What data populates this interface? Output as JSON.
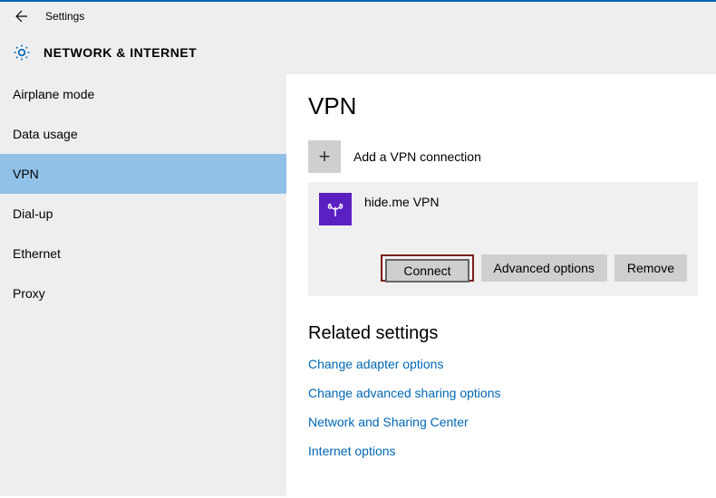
{
  "app": {
    "title": "Settings",
    "section": "NETWORK & INTERNET"
  },
  "sidebar": {
    "items": [
      {
        "label": "Airplane mode",
        "selected": false
      },
      {
        "label": "Data usage",
        "selected": false
      },
      {
        "label": "VPN",
        "selected": true
      },
      {
        "label": "Dial-up",
        "selected": false
      },
      {
        "label": "Ethernet",
        "selected": false
      },
      {
        "label": "Proxy",
        "selected": false
      }
    ]
  },
  "main": {
    "heading": "VPN",
    "add_connection_label": "Add a VPN connection",
    "vpn_entry_name": "hide.me VPN",
    "buttons": {
      "connect": "Connect",
      "advanced": "Advanced options",
      "remove": "Remove"
    },
    "related_heading": "Related settings",
    "links": [
      "Change adapter options",
      "Change advanced sharing options",
      "Network and Sharing Center",
      "Internet options"
    ]
  },
  "colors": {
    "accent": "#0067b3",
    "sidebar_bg": "#eceef0",
    "selected_bg": "#91c1e7",
    "vpn_tile": "#5b20c2",
    "highlight_border": "#7c1e1e"
  }
}
